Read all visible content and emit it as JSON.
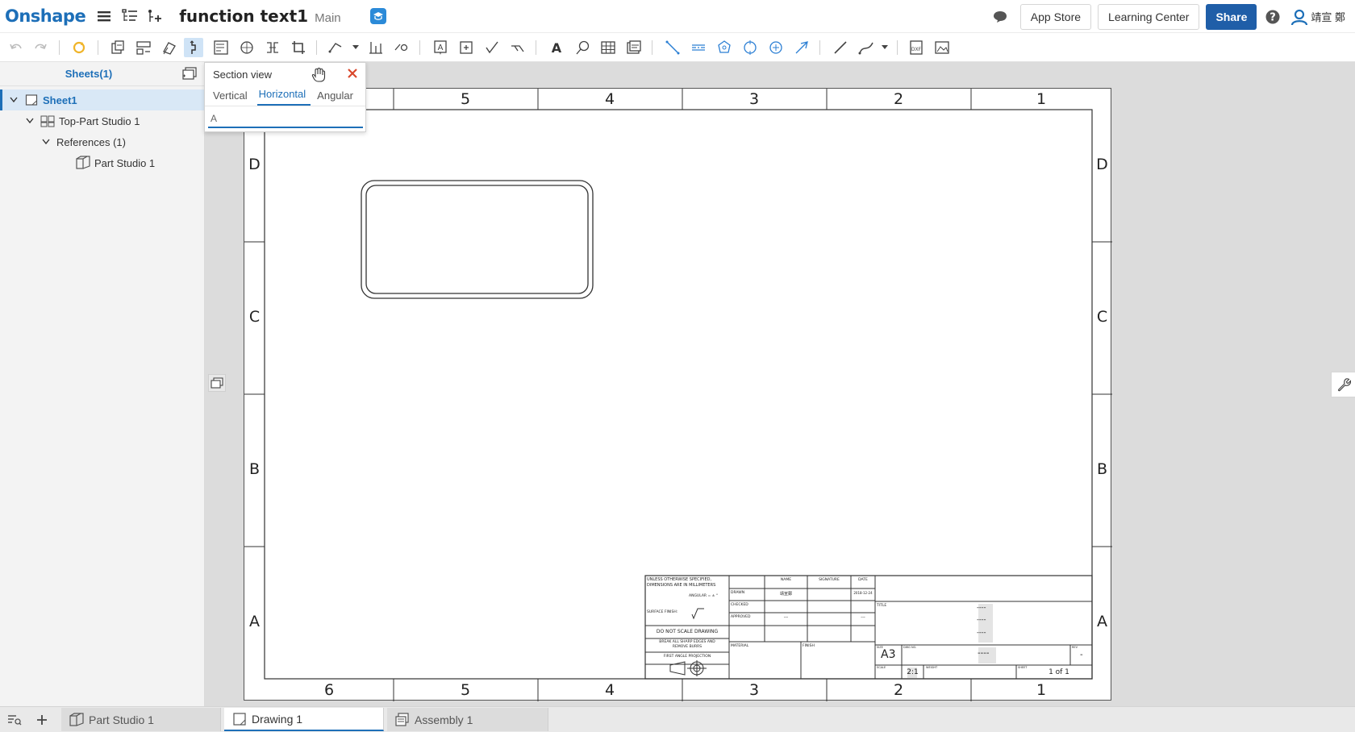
{
  "header": {
    "logo": "Onshape",
    "doc_title": "function text1",
    "branch": "Main",
    "app_store": "App Store",
    "learning_center": "Learning Center",
    "share": "Share",
    "user_name": "靖宣 鄭"
  },
  "left_panel": {
    "title": "Sheets(1)",
    "tree": [
      {
        "label": "Sheet1"
      },
      {
        "label": "Top-Part Studio 1"
      },
      {
        "label": "References (1)"
      },
      {
        "label": "Part Studio 1"
      }
    ]
  },
  "section_dialog": {
    "title": "Section view",
    "tabs": [
      "Vertical",
      "Horizontal",
      "Angular"
    ],
    "active_tab": "Horizontal",
    "input_value": "A"
  },
  "sheet": {
    "col_labels_top": [
      "5",
      "4",
      "3",
      "2",
      "1"
    ],
    "col_labels_bottom": [
      "6",
      "5",
      "4",
      "3",
      "2",
      "1"
    ],
    "row_labels": [
      "D",
      "C",
      "B",
      "A"
    ],
    "title_block": {
      "notes_line1": "UNLESS OTHERWISE SPECIFIED,",
      "notes_line2": "DIMENSIONS ARE IN MILLIMETERS",
      "angular": "ANGULAR = ± °",
      "surface_finish": "SURFACE FINISH:",
      "do_not_scale": "DO NOT SCALE DRAWING",
      "break_edges_1": "BREAK ALL SHARP EDGES AND",
      "break_edges_2": "REMOVE BURRS",
      "projection": "FIRST ANGLE PROJECTION",
      "col_name": "NAME",
      "col_signature": "SIGNATURE",
      "col_date": "DATE",
      "row_drawn": "DRAWN",
      "row_checked": "CHECKED",
      "row_approved": "APPROVED",
      "drawn_name": "靖宣鄭",
      "drawn_date": "2018-12-24",
      "approved_name": "---",
      "approved_date": "---",
      "material": "MATERIAL",
      "finish": "FINISH",
      "title_label": "TITLE",
      "title_dashes": [
        "----",
        "----",
        "----"
      ],
      "size_label": "SIZE",
      "size": "A3",
      "dwg_no_label": "DWG NO.",
      "dwg_no": "----",
      "rev_label": "REV",
      "rev": "-",
      "scale_label": "SCALE",
      "scale": "2:1",
      "weight_label": "WEIGHT",
      "sheet_label": "SHEET",
      "sheet": "1 of 1"
    }
  },
  "bottom_tabs": [
    {
      "label": "Part Studio 1",
      "active": false
    },
    {
      "label": "Drawing 1",
      "active": true
    },
    {
      "label": "Assembly 1",
      "active": false
    }
  ],
  "colors": {
    "brand": "#1d6fb8",
    "share_button": "#1f5ea8",
    "close_x": "#d9472b",
    "canvas_bg": "#dcdcdc"
  },
  "icons": [
    "hamburger-icon",
    "feature-list-icon",
    "insert-icon",
    "education-icon",
    "chat-icon",
    "help-icon",
    "user-avatar-icon",
    "undo-icon",
    "redo-icon",
    "regenerate-icon",
    "close-icon",
    "grab-hand-icon",
    "wrench-icon",
    "filter-icon",
    "add-icon"
  ]
}
